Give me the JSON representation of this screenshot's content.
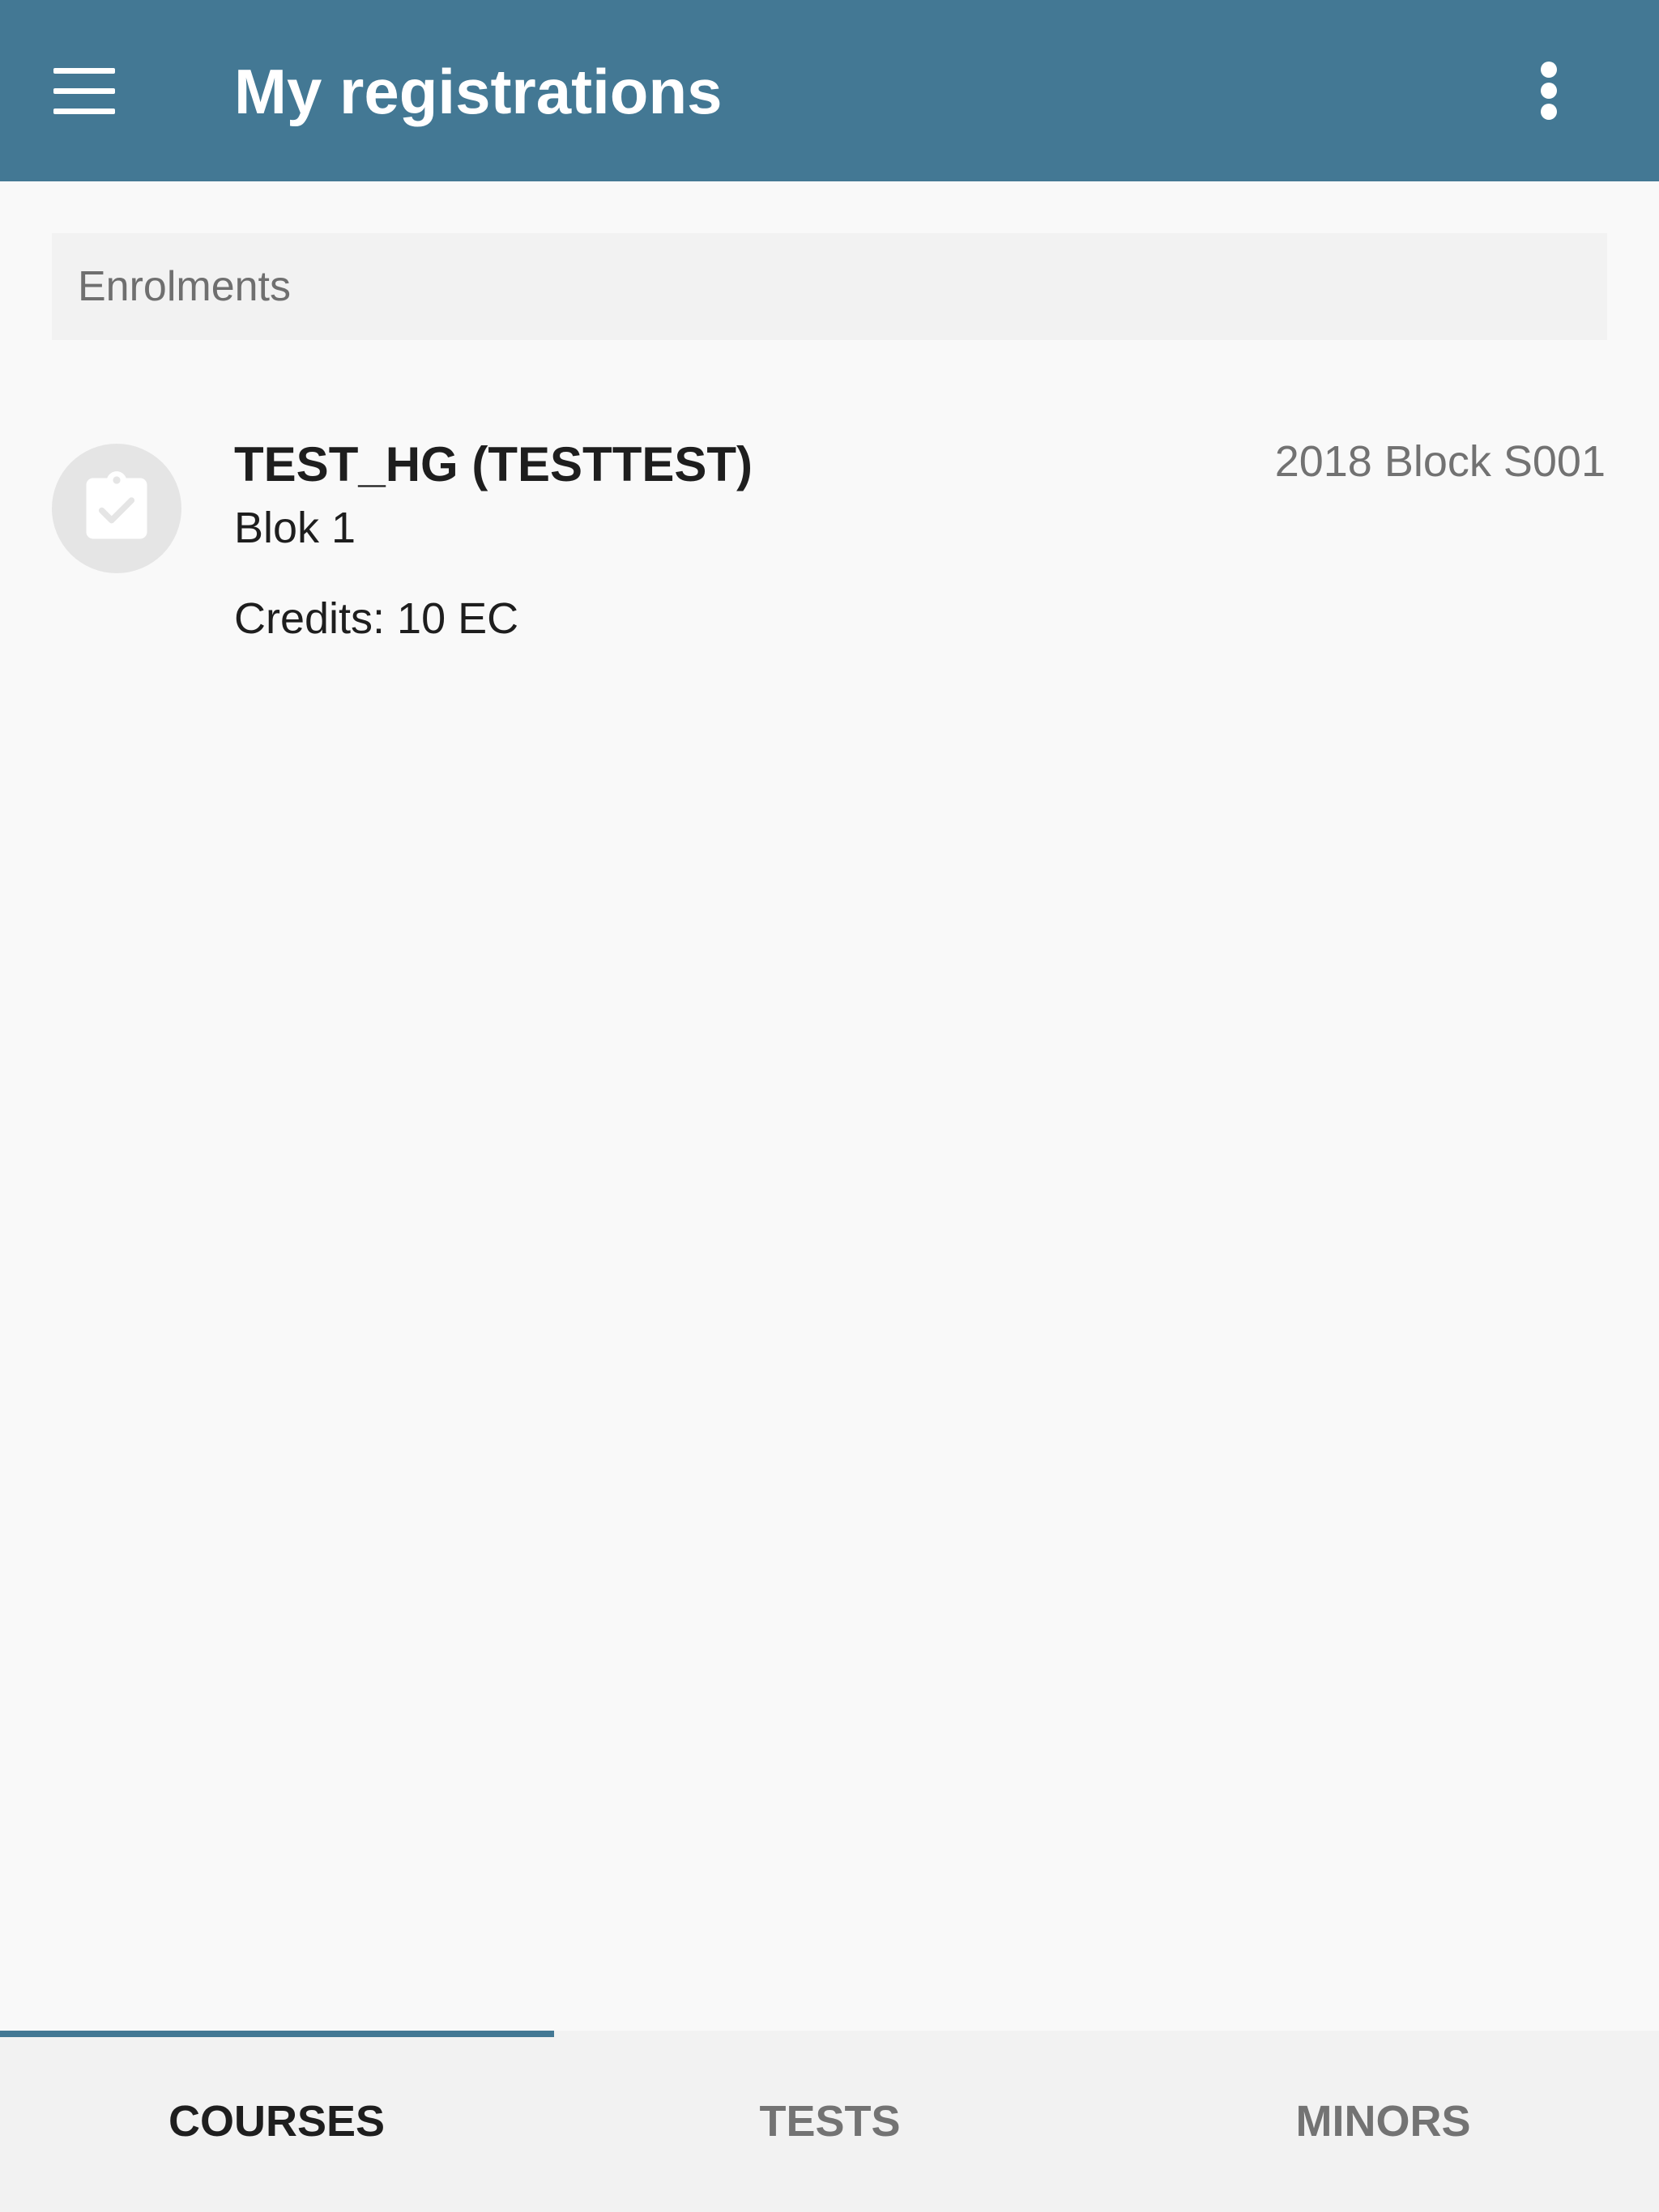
{
  "appbar": {
    "title": "My registrations",
    "menu_icon": "menu-icon",
    "overflow_icon": "more-vert-icon",
    "color": "#437894"
  },
  "section": {
    "header": "Enrolments"
  },
  "courses": [
    {
      "icon": "clipboard-check-icon",
      "title": "TEST_HG (TESTTEST)",
      "block": "Blok 1",
      "credits": "Credits: 10 EC",
      "period": "2018 Block S001"
    }
  ],
  "tabs": [
    {
      "label": "COURSES",
      "active": true
    },
    {
      "label": "TESTS",
      "active": false
    },
    {
      "label": "MINORS",
      "active": false
    }
  ]
}
